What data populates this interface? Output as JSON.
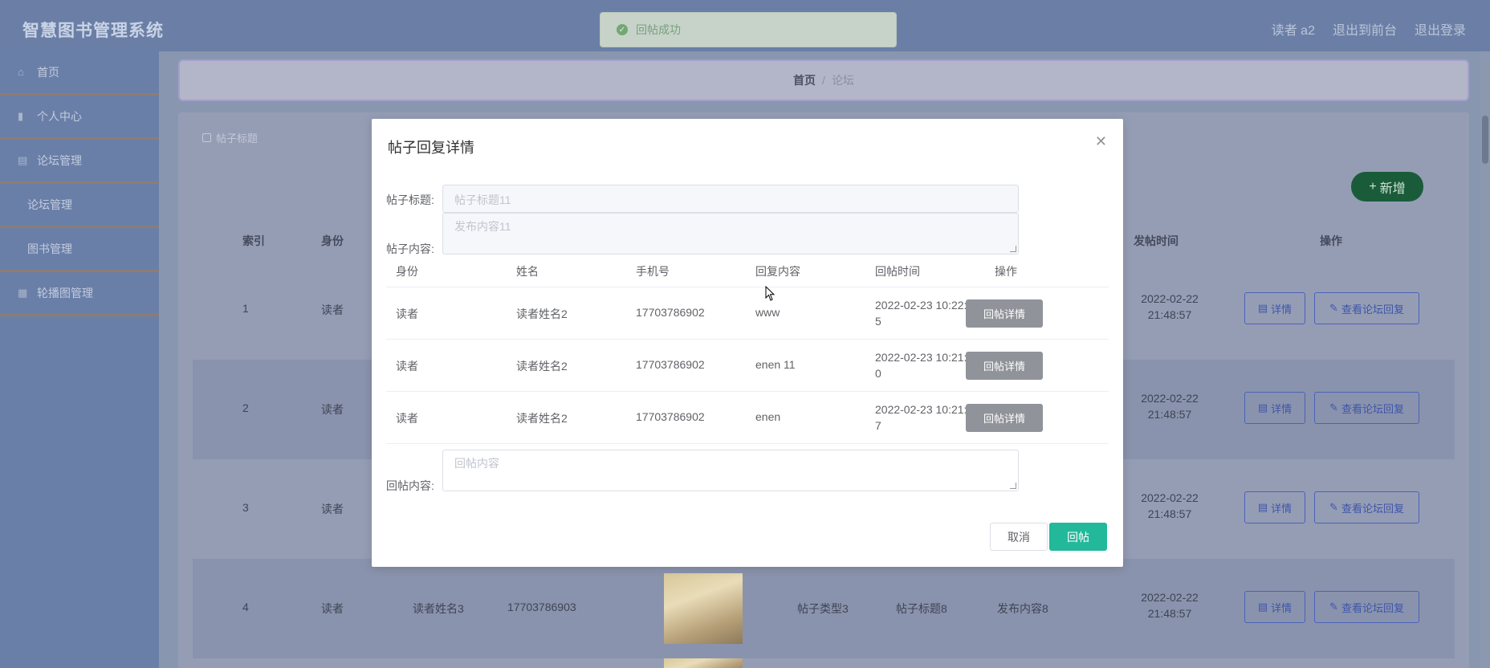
{
  "app": {
    "title": "智慧图书管理系统"
  },
  "header": {
    "user": "读者 a2",
    "back_to_admin": "退出到前台",
    "logout": "退出登录"
  },
  "sidebar": {
    "items": [
      {
        "label": "首页",
        "icon": "home-icon"
      },
      {
        "label": "个人中心",
        "icon": "user-icon"
      },
      {
        "label": "论坛管理",
        "icon": "forum-icon"
      },
      {
        "label": "论坛管理",
        "icon": ""
      },
      {
        "label": "图书管理",
        "icon": ""
      },
      {
        "label": "轮播图管理",
        "icon": "image-icon"
      }
    ]
  },
  "breadcrumb": {
    "home": "首页",
    "separator": "/",
    "current": "论坛"
  },
  "filter": {
    "label": "帖子标题"
  },
  "add_button": "新增",
  "table": {
    "headers": {
      "index": "索引",
      "identity": "身份",
      "post_time": "发帖时间",
      "actions": "操作"
    },
    "rows": [
      {
        "index": "1",
        "identity": "读者",
        "time": "2022-02-22 21:48:57"
      },
      {
        "index": "2",
        "identity": "读者",
        "time": "2022-02-22 21:48:57"
      },
      {
        "index": "3",
        "identity": "读者",
        "time": "2022-02-22 21:48:57"
      },
      {
        "index": "4",
        "identity": "读者",
        "name": "读者姓名3",
        "phone": "17703786903",
        "type": "帖子类型3",
        "title": "帖子标题8",
        "content": "发布内容8",
        "time": "2022-02-22 21:48:57"
      }
    ],
    "detail_label": "详情",
    "replies_label": "查看论坛回复"
  },
  "toast": {
    "message": "回帖成功"
  },
  "modal": {
    "title": "帖子回复详情",
    "post_title_label": "帖子标题:",
    "post_title_value": "帖子标题11",
    "post_content_label": "帖子内容:",
    "post_content_value": "发布内容11",
    "reply_table": {
      "headers": {
        "identity": "身份",
        "name": "姓名",
        "phone": "手机号",
        "content": "回复内容",
        "time": "回帖时间",
        "actions": "操作"
      },
      "rows": [
        {
          "identity": "读者",
          "name": "读者姓名2",
          "phone": "17703786902",
          "content": "www",
          "time": "2022-02-23 10:22:35"
        },
        {
          "identity": "读者",
          "name": "读者姓名2",
          "phone": "17703786902",
          "content": "enen 11",
          "time": "2022-02-23 10:21:40"
        },
        {
          "identity": "读者",
          "name": "读者姓名2",
          "phone": "17703786902",
          "content": "enen",
          "time": "2022-02-23 10:21:37"
        }
      ],
      "row_button": "回帖详情"
    },
    "reply_label": "回帖内容:",
    "reply_placeholder": "回帖内容",
    "cancel": "取消",
    "submit": "回帖"
  },
  "overlay_text": "…"
}
